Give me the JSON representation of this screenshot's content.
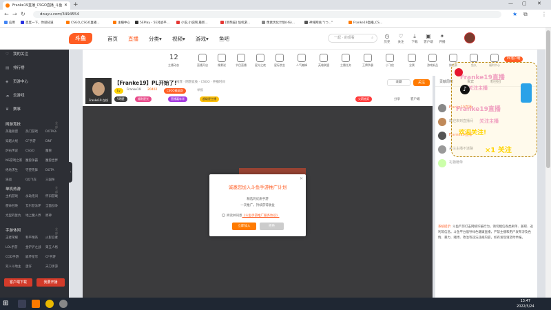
{
  "browser": {
    "tab_title": "Franke19直播_CSGO直播_斗鱼",
    "new_tab": "+",
    "url": "douyu.com/3494554",
    "window_controls": [
      "—",
      "▢",
      "✕"
    ]
  },
  "bookmarks": [
    {
      "label": "应用",
      "color": "#4285f4"
    },
    {
      "label": "百度一下，你就知道",
      "color": "#2932e1"
    },
    {
      "label": "CSGO_CSGO直播...",
      "color": "#ff7a00"
    },
    {
      "label": "主播中心",
      "color": "#ff7a00"
    },
    {
      "label": "5EPlay - 5E对战平...",
      "color": "#333333"
    },
    {
      "label": "小说,小说网,最新...",
      "color": "#e53935"
    },
    {
      "label": "[新熊猫] 恒机游...",
      "color": "#e53935"
    },
    {
      "label": "像素优化计划(HS)...",
      "color": "#888888"
    },
    {
      "label": "神域网站 \"(つ...\"",
      "color": "#555555"
    },
    {
      "label": "Franke19直播_CS...",
      "color": "#ff7a00"
    }
  ],
  "site_nav": {
    "logo": "斗鱼",
    "items": [
      "首页",
      "直播",
      "分类▾",
      "视频▾",
      "游戏▾",
      "鱼吧"
    ],
    "active_index": 1,
    "search_placeholder": "一起 · 的观看",
    "header_icons": [
      {
        "label": "历史",
        "glyph": "◷"
      },
      {
        "label": "关注",
        "glyph": "♡"
      },
      {
        "label": "下载",
        "glyph": "⤓"
      },
      {
        "label": "客户端",
        "glyph": "▣"
      },
      {
        "label": "开播",
        "glyph": "✦"
      }
    ]
  },
  "sidebar": {
    "top_items": [
      {
        "label": "我的关注",
        "icon": "heart-icon"
      },
      {
        "label": "排行榜",
        "icon": "rank-icon"
      },
      {
        "label": "页游中心",
        "icon": "gamepad-icon"
      },
      {
        "label": "云游戏",
        "icon": "cloud-icon"
      },
      {
        "label": "赛事",
        "icon": "trophy-icon"
      }
    ],
    "sections": [
      {
        "title": "网游竞技",
        "more": "全部 >",
        "items": [
          "英雄联盟",
          "热门游戏",
          "DOTA2",
          "穿越火线",
          "CF手游",
          "DNF",
          "炉石传说",
          "CSGO",
          "魔兽",
          "NS游戏之家",
          "魔兽争霸",
          "魔兽世界",
          "绝地求生",
          "守望先锋",
          "DOTA",
          "逆战",
          "QQ飞车",
          "三国杀"
        ]
      },
      {
        "title": "单机热游",
        "more": "全部 >",
        "items": [
          "主机游戏",
          "永劫无间",
          "怀旧游戏",
          "使命召唤",
          "艾尔登法环",
          "全面战争",
          "尤里的复仇",
          "地上魔人界",
          "原神"
        ]
      },
      {
        "title": "手游休闲",
        "more": "全部 >",
        "items": [
          "王者荣耀",
          "和平精英",
          "火影忍者",
          "LOL手游",
          "金铲铲之战",
          "第五人格",
          "COD手游",
          "崩坏星穹",
          "CF手游",
          "双人斗地主",
          "蛋仔",
          "天刀手游"
        ]
      }
    ],
    "buttons": [
      "客户端下载",
      "我要开播"
    ]
  },
  "categories": {
    "count": "12",
    "count_label": "主播动态",
    "items": [
      "直播开启",
      "像素说",
      "节目直播",
      "星光之夜",
      "星际赏金",
      "人气巅峰",
      "英雄联盟",
      "主播任务",
      "王牌争霸",
      "小飞侠",
      "全景",
      "游戏新品",
      "排位赛",
      "鱼丸",
      "福利中心"
    ],
    "pc_label": "PC客户端"
  },
  "room": {
    "title": "【Franke19】PL开始了!",
    "category": "推荐 · 网游竞技 · CSGO · 开播时间",
    "streamer": "Franke19",
    "hot": "20402",
    "report": "举报",
    "tag_rank": "CSGO精英赛",
    "tags": [
      "V明星",
      "福利星光",
      "直播嘉年华",
      "超级星主播"
    ],
    "fav_label": "收藏",
    "follow_label": "关注",
    "cam_caption": "Franke19 在线",
    "right_actions": [
      "火箭抽奖",
      "分享",
      "客户端"
    ]
  },
  "modal": {
    "title": "诚邀您加入斗鱼手游推广计划",
    "line1": "精选的优质手游",
    "line2": "一次推广，持续获得收益",
    "agree_prefix": "阅读并同意",
    "agree_link": "《斗鱼手游推广服务协议》",
    "confirm": "立即加入",
    "cancel": "拒绝",
    "close": "✕"
  },
  "right_panel": {
    "tabs": [
      "贡献周榜",
      "贵宾",
      "粉丝团"
    ],
    "chat_rows": [
      {
        "name": "Franke19直播",
        "color": "#d14"
      },
      {
        "name": "欢迎来到直播间",
        "color": "#888"
      },
      {
        "name": "Franke19直播",
        "color": "#d14"
      },
      {
        "name": "关注主播不迷路",
        "color": "#888"
      },
      {
        "name": "礼物榜单",
        "color": "#999"
      }
    ],
    "notice_label": "系统提示:",
    "notice_text": "斗鱼严厉打击网络诈骗行为，请勿相信各类刷单、兼职、返利等信息。斗鱼平台倡导绿色健康直播，严禁主播和用户发布涉及色情、暴力、赌博、政治等违法违规内容，如有发现请及时举报。"
  },
  "overlay": {
    "lines": [
      "Franke19直播",
      "关注主播",
      "Franke19直播",
      "关注主播",
      "Franke19直播"
    ],
    "big_line": "欢迎关注!",
    "rank_line": "×1 关注"
  },
  "taskbar": {
    "time": "13:47",
    "date": "2022/5/24"
  },
  "colors": {
    "brand": "#ff5d23",
    "sidebar_bg": "#2d2f35",
    "player_bg": "#3b3b3d"
  }
}
